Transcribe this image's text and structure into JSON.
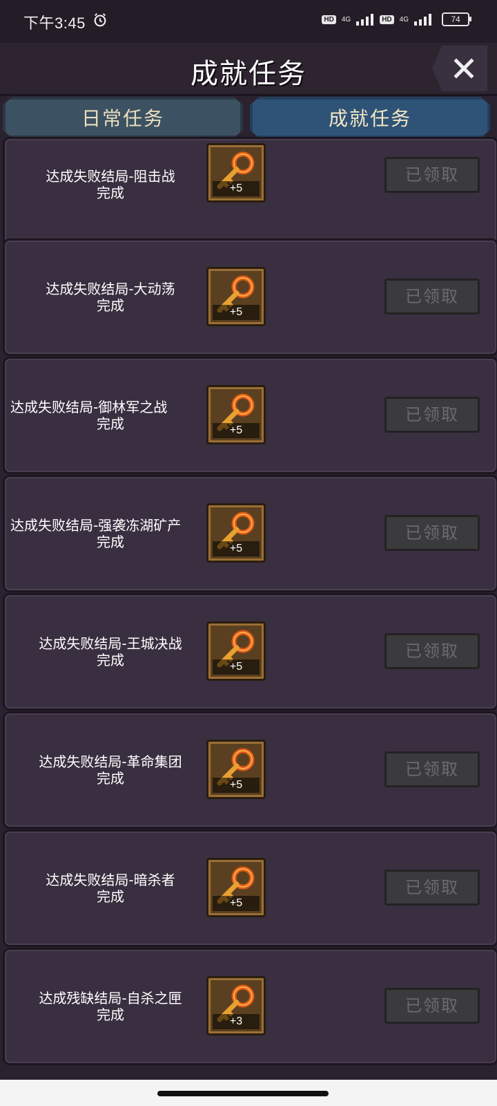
{
  "status_bar": {
    "time": "下午3:45",
    "network_1": "4G",
    "network_2": "4G",
    "hd_1": "HD",
    "hd_2": "HD",
    "battery": "74"
  },
  "header": {
    "title": "成就任务"
  },
  "tabs": [
    {
      "label": "日常任务"
    },
    {
      "label": "成就任务"
    }
  ],
  "tasks": [
    {
      "name": "达成失败结局-阻击战",
      "status": "完成",
      "reward_qty": "+5",
      "button": "已领取"
    },
    {
      "name": "达成失败结局-大动荡",
      "status": "完成",
      "reward_qty": "+5",
      "button": "已领取"
    },
    {
      "name": "达成失败结局-御林军之战",
      "status": "完成",
      "reward_qty": "+5",
      "button": "已领取"
    },
    {
      "name": "达成失败结局-强袭冻湖矿产",
      "status": "完成",
      "reward_qty": "+5",
      "button": "已领取"
    },
    {
      "name": "达成失败结局-王城决战",
      "status": "完成",
      "reward_qty": "+5",
      "button": "已领取"
    },
    {
      "name": "达成失败结局-革命集团",
      "status": "完成",
      "reward_qty": "+5",
      "button": "已领取"
    },
    {
      "name": "达成失败结局-暗杀者",
      "status": "完成",
      "reward_qty": "+5",
      "button": "已领取"
    },
    {
      "name": "达成残缺结局-自杀之匣",
      "status": "完成",
      "reward_qty": "+3",
      "button": "已领取"
    }
  ],
  "colors": {
    "background": "#2b2230",
    "card": "#3a2f40",
    "tab_active": "#2f5377",
    "tab_inactive": "#3c5161",
    "button_disabled": "#3b3b3d",
    "key": "#e05a18"
  },
  "icons": {
    "alarm": "alarm-icon",
    "close": "close-icon",
    "reward": "key-icon"
  }
}
